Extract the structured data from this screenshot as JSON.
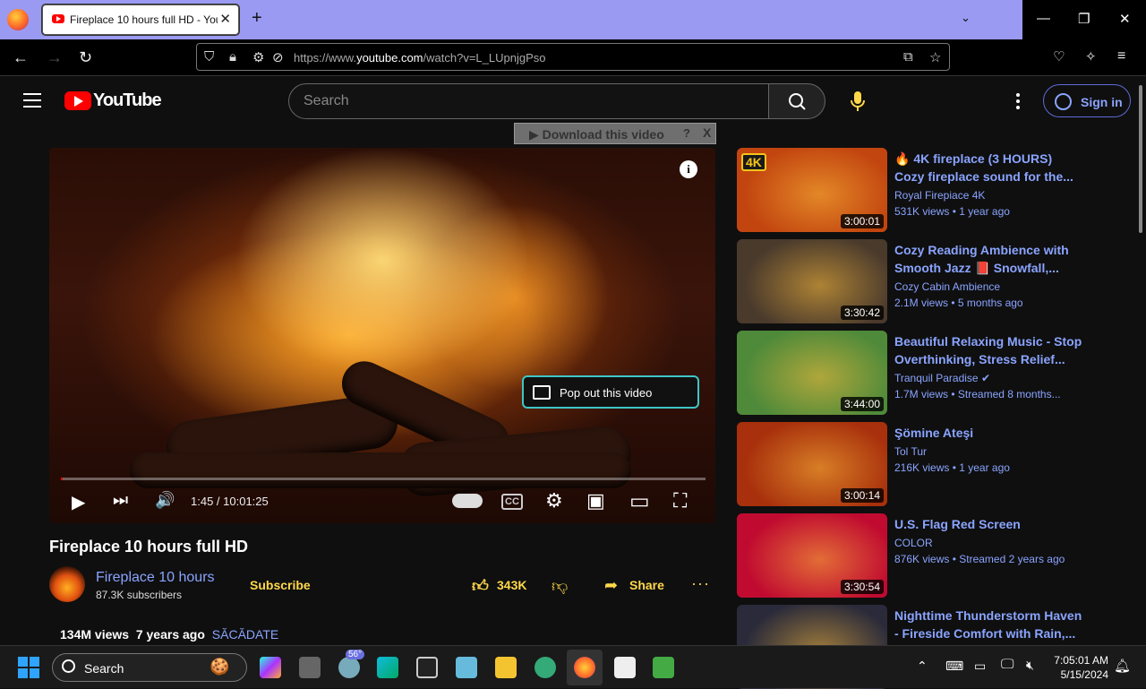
{
  "browser": {
    "tab_title": "Fireplace 10 hours full HD - YouTube",
    "tab_close": "✕",
    "new_tab": "+",
    "tab_list": "⌄",
    "window_controls": {
      "minimize": "—",
      "restore": "❐",
      "close": "✕"
    },
    "nav": {
      "back": "←",
      "forward": "→",
      "reload": "↻"
    },
    "url_prefix": "https://www.",
    "url_domain": "youtube.com",
    "url_path": "/watch?v=L_LUpnjgPso"
  },
  "youtube": {
    "logo_text": "YouTube",
    "search_placeholder": "Search",
    "sign_in": "Sign in"
  },
  "download_bar": {
    "label": "▶ Download this video",
    "help": "?",
    "close": "X"
  },
  "player": {
    "info": "i",
    "popout": "Pop out this video",
    "time": "1:45 / 10:01:25",
    "progress_fraction": 0.0029,
    "controls": {
      "play": "▶",
      "next": "⏭",
      "volume": "🔊",
      "cc": "CC",
      "settings": "⚙",
      "miniplayer": "▣",
      "theater": "▭",
      "fullscreen": "⛶"
    }
  },
  "video": {
    "title": "Fireplace 10 hours full HD",
    "channel": "Fireplace 10 hours",
    "subscribers": "87.3K subscribers",
    "subscribe": "Subscribe",
    "likes": "343K",
    "share": "Share",
    "more": "···",
    "views": "134M views",
    "age": "7 years ago",
    "tag": "SĂCĂDATE"
  },
  "recommendations": [
    {
      "title": "🔥 4K fireplace (3 HOURS) Cozy fireplace sound for the...",
      "channel": "Royal Firepiace 4K",
      "meta": "531K views • 1 year ago",
      "duration": "3:00:01",
      "badge": "4K",
      "thumb_color": "#c2450f"
    },
    {
      "title": "Cozy Reading Ambience with Smooth Jazz 📕 Snowfall,...",
      "channel": "Cozy Cabin Ambience",
      "meta": "2.1M views • 5 months ago",
      "duration": "3:30:42",
      "thumb_color": "#4a3a2c"
    },
    {
      "title": "Beautiful Relaxing Music - Stop Overthinking, Stress Relief...",
      "channel": "Tranquil Paradise ✔",
      "meta": "1.7M views • Streamed 8 months...",
      "duration": "3:44:00",
      "thumb_color": "#4f8a3a"
    },
    {
      "title": "Şömine Ateşi",
      "channel": "Tol Tur",
      "meta": "216K views • 1 year ago",
      "duration": "3:00:14",
      "thumb_color": "#a8300c"
    },
    {
      "title": "U.S. Flag Red Screen",
      "channel": "COLOR",
      "meta": "876K views • Streamed 2 years ago",
      "duration": "3:30:54",
      "thumb_color": "#c00a30"
    },
    {
      "title": "Nighttime Thunderstorm Haven - Fireside Comfort with Rain,...",
      "channel": "",
      "meta": "",
      "duration": "",
      "thumb_color": "#2a2a3a"
    }
  ],
  "taskbar": {
    "search": "Search",
    "weather_badge": "56°",
    "time": "7:05:01 AM",
    "date": "5/15/2024"
  }
}
